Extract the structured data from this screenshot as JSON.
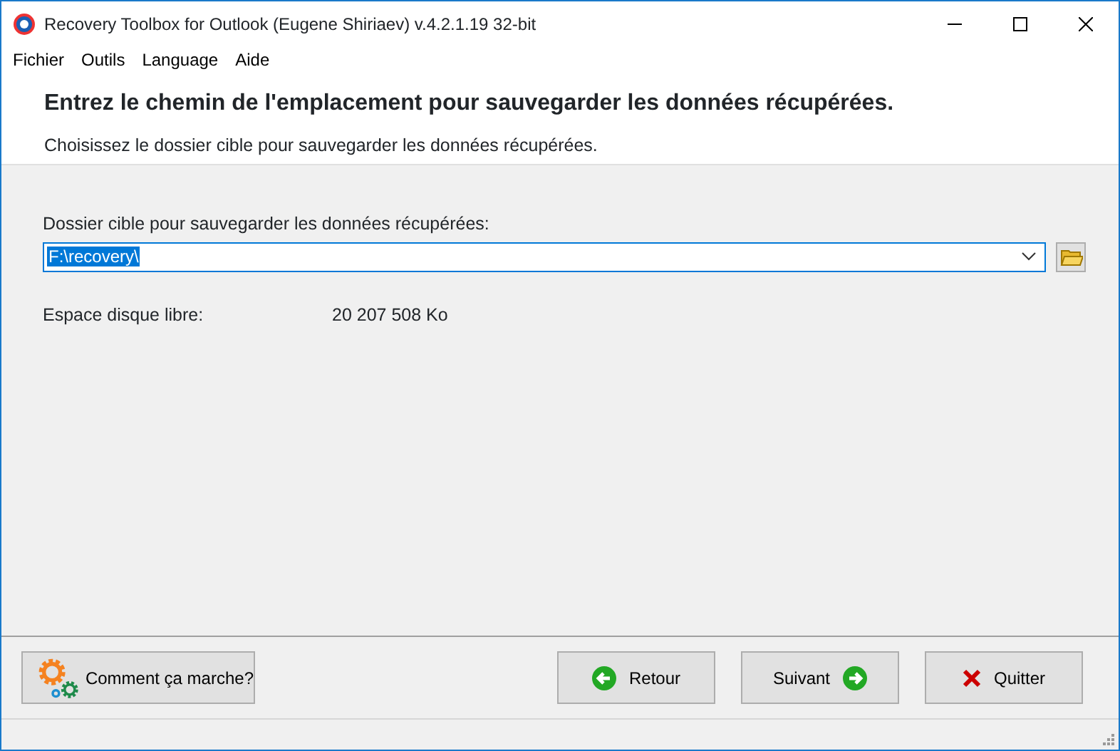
{
  "window": {
    "title": "Recovery Toolbox for Outlook (Eugene Shiriaev) v.4.2.1.19 32-bit"
  },
  "menu": [
    "Fichier",
    "Outils",
    "Language",
    "Aide"
  ],
  "header": {
    "title": "Entrez le chemin de l'emplacement pour sauvegarder les données récupérées.",
    "subtitle": "Choisissez le dossier cible pour sauvegarder les données récupérées."
  },
  "folder": {
    "label": "Dossier cible pour sauvegarder les données récupérées:",
    "value": "F:\\recovery\\"
  },
  "free_space": {
    "label": "Espace disque libre:",
    "value": "20 207 508 Ko"
  },
  "buttons": [
    {
      "kind": "help",
      "label": "Comment ça marche?"
    },
    {
      "kind": "back",
      "label": "Retour"
    },
    {
      "kind": "next",
      "label": "Suivant"
    },
    {
      "kind": "quit",
      "label": "Quitter"
    }
  ]
}
